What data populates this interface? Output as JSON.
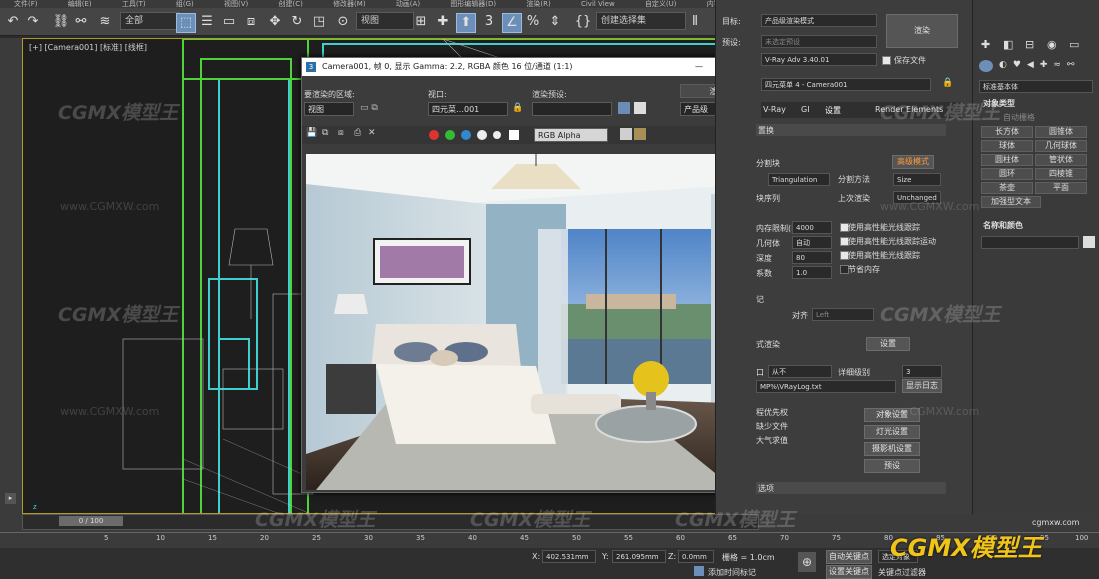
{
  "menu": [
    "文件(F)",
    "编辑(E)",
    "工具(T)",
    "组(G)",
    "视图(V)",
    "创建(C)",
    "修改器(M)",
    "动画(A)",
    "图形编辑器(D)",
    "渲染(R)",
    "Civil View",
    "自定义(U)",
    "内容"
  ],
  "toolbar": {
    "selection_filter": "全部",
    "view_drop": "视图",
    "named_selection": "创建选择集"
  },
  "viewport": {
    "label": "[+] [Camera001] [标准] [线框]"
  },
  "render_dialog": {
    "title": "Camera001, 帧 0, 显示 Gamma: 2.2, RGBA 颜色 16 位/通道 (1:1)",
    "area_label": "要渲染的区域:",
    "area_value": "视图",
    "viewport_label": "视口:",
    "viewport_value": "四元菜…001",
    "preset_label": "渲染预设:",
    "preset_value": "",
    "render_button": "渲染",
    "product_value": "产品级",
    "channel_value": "RGB Alpha"
  },
  "render_setup": {
    "target_label": "目标:",
    "target_value": "产品级渲染模式",
    "preset_label": "预设:",
    "preset_value": "未选定预设",
    "renderer_label": "渲染器:",
    "renderer_value": "V-Ray Adv 3.40.01",
    "save_file": "保存文件",
    "view_label": "查看到渲染:",
    "view_value": "四元菜单 4 - Camera001",
    "render_button": "渲染",
    "tabs": [
      "V-Ray",
      "GI",
      "设置",
      "Render Elements"
    ],
    "section_title": "置换",
    "bucket_label": "分割块",
    "bucket_mode": "高级模式",
    "bucket_value": "Triangulation",
    "split_method_label": "分割方法",
    "split_method_value": "Size",
    "seq_label": "块序列",
    "last_render_label": "上次渲染",
    "last_render_value": "Unchanged",
    "dyn_mem_label": "内存限制(M)",
    "dyn_mem_value": "4000",
    "geom_label": "几何体",
    "geom_value": "自动",
    "depth_label": "深度",
    "depth_value": "80",
    "coeff_label": "系数",
    "coeff_value": "1.0",
    "checks": [
      "使用高性能光线跟踪",
      "使用高性能光线跟踪运动",
      "使用高性能光线跟踪",
      "节省内存"
    ],
    "log_title": "记",
    "align_label": "对齐",
    "align_value": "Left",
    "dist_title": "式渲染",
    "dist_button": "设置",
    "log_label": "口",
    "log_mode": "从不",
    "verbosity_label": "详细级别",
    "verbosity_value": "3",
    "log_path": "MP%\\VRayLog.txt",
    "show_log": "显示日志",
    "priority_label": "程优先权",
    "missing_label": "缺少文件",
    "atmos_label": "大气求值",
    "btn_obj": "对象设置",
    "btn_light": "灯光设置",
    "btn_cam": "摄影机设置",
    "btn_pre": "预设",
    "bottom_section": "选项"
  },
  "command_panel": {
    "category": "标准基本体",
    "object_type": "对象类型",
    "auto_grid": "自动栅格",
    "buttons": [
      "长方体",
      "圆锥体",
      "球体",
      "几何球体",
      "圆柱体",
      "管状体",
      "圆环",
      "四棱锥",
      "茶壶",
      "平面",
      "加强型文本"
    ],
    "name_color": "名称和颜色"
  },
  "timeline": {
    "frame": "0 / 100",
    "ticks": [
      "5",
      "10",
      "15",
      "20",
      "25",
      "30",
      "35",
      "40",
      "45",
      "50",
      "55",
      "60",
      "65",
      "70",
      "75",
      "80",
      "85",
      "90",
      "95",
      "100"
    ],
    "x_label": "X:",
    "x_value": "402.531mm",
    "y_label": "Y:",
    "y_value": "261.095mm",
    "z_label": "Z:",
    "z_value": "0.0mm",
    "grid_label": "栅格 = 1.0cm",
    "add_time_tag": "添加时间标记",
    "auto_key": "自动关键点",
    "set_key": "设置关键点",
    "selected": "选定对象",
    "key_filter": "关键点过滤器"
  },
  "watermarks": {
    "logo": "CGMX模型王",
    "url": "www.CGMXW.com",
    "site": "cgmxw.com"
  }
}
